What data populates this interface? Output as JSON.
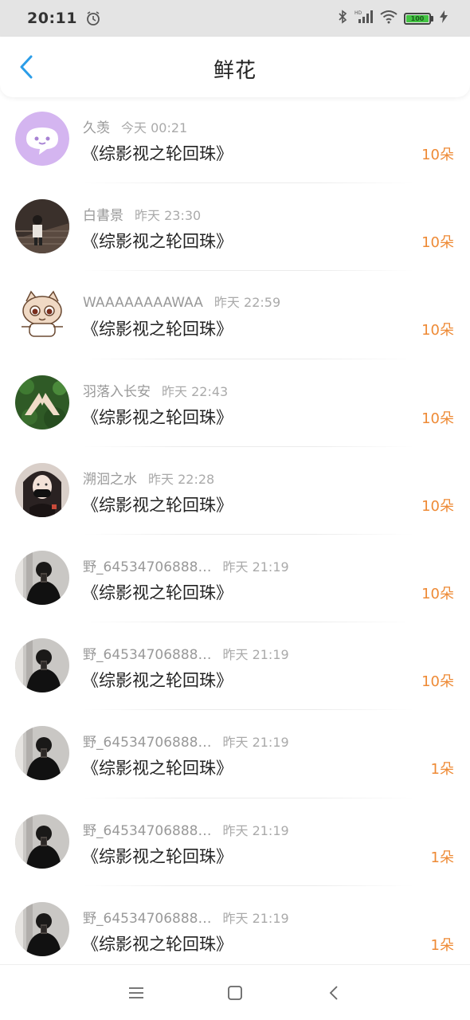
{
  "status_bar": {
    "time": "20:11",
    "battery": "100",
    "icons": [
      "alarm-icon",
      "bluetooth-icon",
      "hd-signal-icon",
      "wifi-icon",
      "battery-icon",
      "charging-icon"
    ]
  },
  "header": {
    "title": "鲜花",
    "back_icon": "chevron-left-icon"
  },
  "colors": {
    "accent": "#2b9de8",
    "count": "#ee8a35",
    "status_bar_bg": "#e4e4e4"
  },
  "items": [
    {
      "name": "久羡",
      "time": "今天 00:21",
      "book": "《综影视之轮回珠》",
      "count": "10朵",
      "avatar": "purple-chat-avatar"
    },
    {
      "name": "白書景",
      "time": "昨天 23:30",
      "book": "《综影视之轮回珠》",
      "count": "10朵",
      "avatar": "stairs-photo-avatar"
    },
    {
      "name": "WAAAAAAAAWAA",
      "time": "昨天 22:59",
      "book": "《综影视之轮回珠》",
      "count": "10朵",
      "avatar": "cartoon-cat-avatar"
    },
    {
      "name": "羽落入长安",
      "time": "昨天 22:43",
      "book": "《综影视之轮回珠》",
      "count": "10朵",
      "avatar": "hands-grass-avatar"
    },
    {
      "name": "溯洄之水",
      "time": "昨天 22:28",
      "book": "《综影视之轮回珠》",
      "count": "10朵",
      "avatar": "masked-girl-avatar"
    },
    {
      "name": "野_64534706888…",
      "time": "昨天 21:19",
      "book": "《综影视之轮回珠》",
      "count": "10朵",
      "avatar": "dark-selfie-avatar"
    },
    {
      "name": "野_64534706888…",
      "time": "昨天 21:19",
      "book": "《综影视之轮回珠》",
      "count": "10朵",
      "avatar": "dark-selfie-avatar"
    },
    {
      "name": "野_64534706888…",
      "time": "昨天 21:19",
      "book": "《综影视之轮回珠》",
      "count": "1朵",
      "avatar": "dark-selfie-avatar"
    },
    {
      "name": "野_64534706888…",
      "time": "昨天 21:19",
      "book": "《综影视之轮回珠》",
      "count": "1朵",
      "avatar": "dark-selfie-avatar"
    },
    {
      "name": "野_64534706888…",
      "time": "昨天 21:19",
      "book": "《综影视之轮回珠》",
      "count": "1朵",
      "avatar": "dark-selfie-avatar"
    }
  ],
  "bottom_nav": {
    "icons": [
      "menu-icon",
      "home-icon",
      "back-icon"
    ]
  }
}
